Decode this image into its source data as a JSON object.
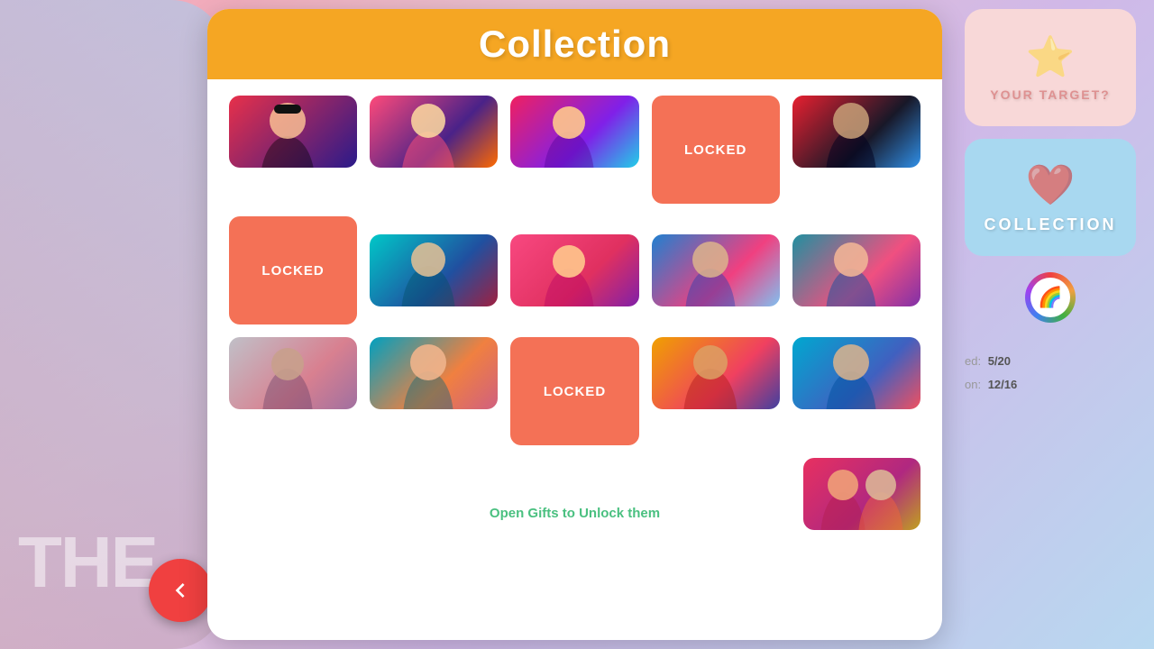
{
  "page": {
    "title": "Collection",
    "background_color": "#f8a0b0"
  },
  "header": {
    "title": "Collection",
    "bg_color": "#f5a623"
  },
  "grid": {
    "rows": [
      {
        "cells": [
          {
            "type": "image",
            "style": "img1",
            "alt": "character-1"
          },
          {
            "type": "image",
            "style": "img2",
            "alt": "character-2"
          },
          {
            "type": "image",
            "style": "img3",
            "alt": "character-3"
          },
          {
            "type": "locked",
            "size": "large",
            "label": "LOCKED"
          },
          {
            "type": "image",
            "style": "img5",
            "alt": "character-5"
          }
        ]
      },
      {
        "cells": [
          {
            "type": "locked",
            "size": "large",
            "label": "LOCKED"
          },
          {
            "type": "image",
            "style": "img6",
            "alt": "character-6"
          },
          {
            "type": "image",
            "style": "img7",
            "alt": "character-7"
          },
          {
            "type": "image",
            "style": "img8",
            "alt": "character-8"
          },
          {
            "type": "image",
            "style": "img9",
            "alt": "character-9"
          }
        ]
      },
      {
        "cells": [
          {
            "type": "image",
            "style": "img10",
            "alt": "character-10"
          },
          {
            "type": "image",
            "style": "img11",
            "alt": "character-11"
          },
          {
            "type": "locked",
            "size": "large",
            "label": "LOCKED"
          },
          {
            "type": "image",
            "style": "img13",
            "alt": "character-13"
          },
          {
            "type": "image",
            "style": "img14",
            "alt": "character-14"
          }
        ]
      }
    ],
    "extra_card": {
      "type": "image",
      "style": "img15",
      "alt": "character-15"
    }
  },
  "unlock_text": "Open Gifts to Unlock them",
  "side_cards": [
    {
      "id": "target",
      "bg_color": "#f8d8d8",
      "icon": "⭐",
      "label": "YOUR TARGET?"
    },
    {
      "id": "collection",
      "bg_color": "#a8d8f0",
      "icon": "❤️",
      "label": "COLLECTION"
    }
  ],
  "emoji_badge": "🌈",
  "stats": {
    "achieved_label": "ed:",
    "achieved_value": "5/20",
    "collection_label": "on:",
    "collection_value": "12/16"
  },
  "back_button": {
    "label": "‹",
    "color": "#f04040"
  },
  "bg_text": "THE"
}
